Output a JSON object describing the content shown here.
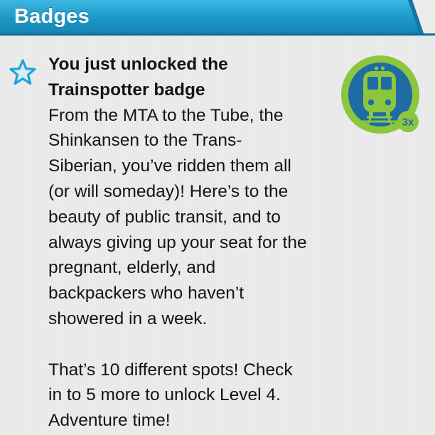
{
  "header": {
    "title": "Badges"
  },
  "notification": {
    "icon": "star-outline-icon",
    "title_lines": [
      "You just unlocked the",
      "Trainspotter badge"
    ],
    "body_lines": [
      "From the MTA to the Tube, the",
      "Shinkansen to the Trans-",
      "Siberian, you’ve ridden them all",
      "(or will someday)! Here’s to the",
      "beauty of public transit, and to",
      "always giving up your seat for the",
      "pregnant, elderly, and",
      "backpackers who haven’t",
      "showered in a week."
    ],
    "progress_lines": [
      "That’s 10 different spots! Check",
      "in to 5 more to unlock Level 4.",
      "Adventure time!"
    ]
  },
  "badge": {
    "icon": "train-icon",
    "multiplier": "3x"
  },
  "colors": {
    "header_blue": "#1e98c8",
    "star_blue": "#1ea3d8",
    "badge_green": "#8cc63e",
    "badge_blue": "#1f6ba4",
    "page_background": "#ececec"
  }
}
